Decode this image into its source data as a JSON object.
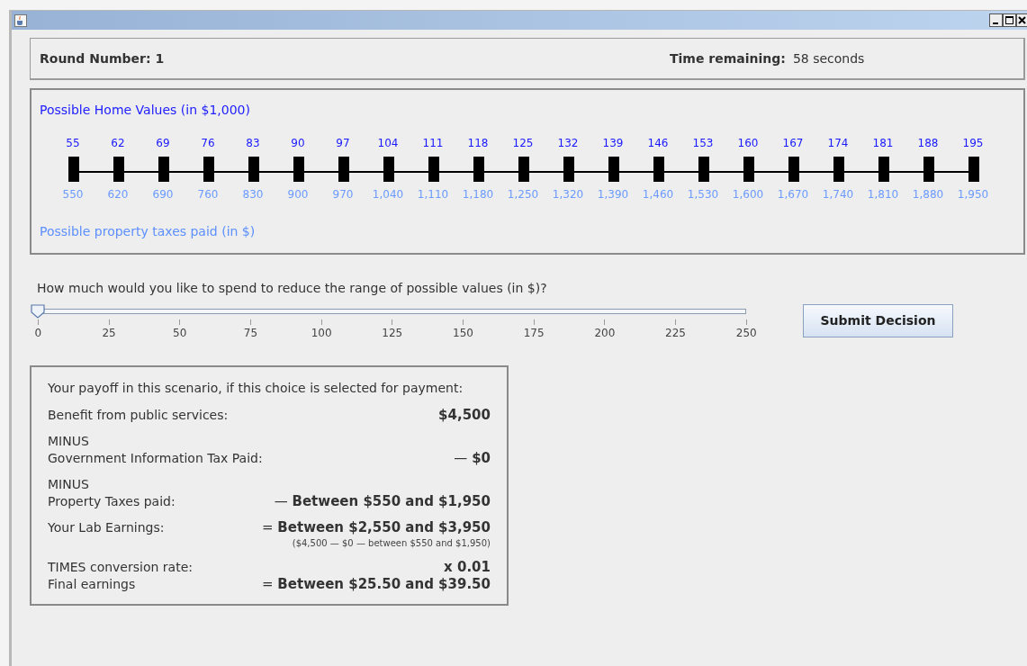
{
  "header": {
    "round_label": "Round Number: 1",
    "time_label": "Time remaining:",
    "time_value": "58 seconds"
  },
  "values_panel": {
    "title": "Possible Home Values (in $1,000)",
    "footer": "Possible property taxes paid (in $)",
    "points": [
      {
        "value": "55",
        "tax": "550"
      },
      {
        "value": "62",
        "tax": "620"
      },
      {
        "value": "69",
        "tax": "690"
      },
      {
        "value": "76",
        "tax": "760"
      },
      {
        "value": "83",
        "tax": "830"
      },
      {
        "value": "90",
        "tax": "900"
      },
      {
        "value": "97",
        "tax": "970"
      },
      {
        "value": "104",
        "tax": "1,040"
      },
      {
        "value": "111",
        "tax": "1,110"
      },
      {
        "value": "118",
        "tax": "1,180"
      },
      {
        "value": "125",
        "tax": "1,250"
      },
      {
        "value": "132",
        "tax": "1,320"
      },
      {
        "value": "139",
        "tax": "1,390"
      },
      {
        "value": "146",
        "tax": "1,460"
      },
      {
        "value": "153",
        "tax": "1,530"
      },
      {
        "value": "160",
        "tax": "1,600"
      },
      {
        "value": "167",
        "tax": "1,670"
      },
      {
        "value": "174",
        "tax": "1,740"
      },
      {
        "value": "181",
        "tax": "1,810"
      },
      {
        "value": "188",
        "tax": "1,880"
      },
      {
        "value": "195",
        "tax": "1,950"
      }
    ]
  },
  "spend": {
    "question": "How much would you like to spend to reduce the range of possible values (in $)?",
    "level": 0,
    "ticks": [
      "0",
      "25",
      "50",
      "75",
      "100",
      "125",
      "150",
      "175",
      "200",
      "225",
      "250"
    ]
  },
  "submit_button": "Submit Decision",
  "payoff": {
    "title": "Your payoff in this scenario, if this choice is selected for payment:",
    "rows": [
      {
        "lines": [
          {
            "label": "Benefit from public services:",
            "value": "**$4,500**"
          }
        ]
      },
      {
        "lines": [
          {
            "label": "MINUS"
          },
          {
            "label": "Government Information Tax Paid:",
            "value": "— **$0**"
          }
        ]
      },
      {
        "lines": [
          {
            "label": "MINUS"
          },
          {
            "label": "Property Taxes paid:",
            "value": "— **Between $550 and $1,950**"
          }
        ]
      },
      {
        "lines": [
          {
            "label": "Your Lab Earnings:",
            "value": "= **Between $2,550 and $3,950**"
          }
        ],
        "note": "($4,500 — $0 — between $550 and $1,950)"
      },
      {
        "lines": [
          {
            "label": "TIMES conversion rate:",
            "value": "**x 0.01**"
          },
          {
            "label": "Final earnings",
            "value": "= **Between $25.50 and $39.50**"
          }
        ]
      }
    ]
  }
}
